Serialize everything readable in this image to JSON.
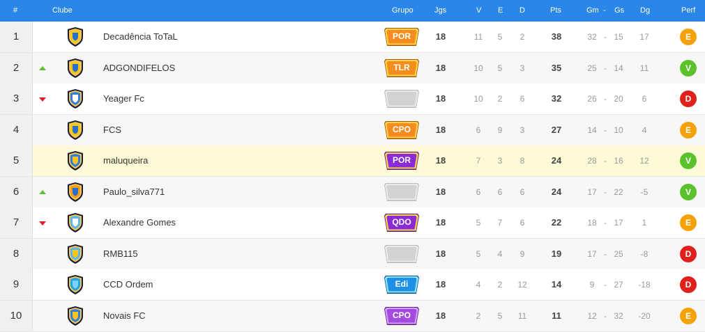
{
  "header": {
    "pos": "#",
    "clube": "Clube",
    "grupo": "Grupo",
    "jgs": "Jgs",
    "v": "V",
    "e": "E",
    "d": "D",
    "pts": "Pts",
    "gm": "Gm",
    "sep": "-",
    "gs": "Gs",
    "dg": "Dg",
    "perf": "Perf"
  },
  "colors": {
    "header_bg": "#2a86e8",
    "highlight_row": "#fdfbd7",
    "alt_row": "#f7f7f7",
    "perf_E": "#f5a20a",
    "perf_V": "#5bc22b",
    "perf_D": "#e0201b"
  },
  "rows": [
    {
      "pos": "1",
      "trend": "none",
      "team": "Decadência ToTaL",
      "crest": "shield-yellow-icon",
      "grupo": "POR",
      "grupo_style": "orange",
      "jgs": "18",
      "v": "11",
      "e": "5",
      "d": "2",
      "pts": "38",
      "gm": "32",
      "sep": "-",
      "gs": "15",
      "dg": "17",
      "perf": "E",
      "highlight": false
    },
    {
      "pos": "2",
      "trend": "up",
      "team": "ADGONDIFELOS",
      "crest": "shield-blue-yellow-icon",
      "grupo": "TLR",
      "grupo_style": "orange",
      "jgs": "18",
      "v": "10",
      "e": "5",
      "d": "3",
      "pts": "35",
      "gm": "25",
      "sep": "-",
      "gs": "14",
      "dg": "11",
      "perf": "V",
      "highlight": false
    },
    {
      "pos": "3",
      "trend": "down",
      "team": "Yeager Fc",
      "crest": "shield-blue-white-icon",
      "grupo": "",
      "grupo_style": "empty",
      "jgs": "18",
      "v": "10",
      "e": "2",
      "d": "6",
      "pts": "32",
      "gm": "26",
      "sep": "-",
      "gs": "20",
      "dg": "6",
      "perf": "D",
      "highlight": false
    },
    {
      "pos": "4",
      "trend": "none",
      "team": "FCS",
      "crest": "shield-yellow-blue-icon",
      "grupo": "CPO",
      "grupo_style": "orange",
      "jgs": "18",
      "v": "6",
      "e": "9",
      "d": "3",
      "pts": "27",
      "gm": "14",
      "sep": "-",
      "gs": "10",
      "dg": "4",
      "perf": "E",
      "highlight": false
    },
    {
      "pos": "5",
      "trend": "none",
      "team": "maluqueira",
      "crest": "shield-checkered-icon",
      "grupo": "POR",
      "grupo_style": "purple",
      "jgs": "18",
      "v": "7",
      "e": "3",
      "d": "8",
      "pts": "24",
      "gm": "28",
      "sep": "-",
      "gs": "16",
      "dg": "12",
      "perf": "V",
      "highlight": true
    },
    {
      "pos": "6",
      "trend": "up",
      "team": "Paulo_silva771",
      "crest": "shield-orange-blue-icon",
      "grupo": "",
      "grupo_style": "empty",
      "jgs": "18",
      "v": "6",
      "e": "6",
      "d": "6",
      "pts": "24",
      "gm": "17",
      "sep": "-",
      "gs": "22",
      "dg": "-5",
      "perf": "V",
      "highlight": false
    },
    {
      "pos": "7",
      "trend": "down",
      "team": "Alexandre Gomes",
      "crest": "shield-sky-blue-icon",
      "grupo": "QDO",
      "grupo_style": "purple",
      "jgs": "18",
      "v": "5",
      "e": "7",
      "d": "6",
      "pts": "22",
      "gm": "18",
      "sep": "-",
      "gs": "17",
      "dg": "1",
      "perf": "E",
      "highlight": false
    },
    {
      "pos": "8",
      "trend": "none",
      "team": "RMB115",
      "crest": "shield-striped-icon",
      "grupo": "",
      "grupo_style": "empty",
      "jgs": "18",
      "v": "5",
      "e": "4",
      "d": "9",
      "pts": "19",
      "gm": "17",
      "sep": "-",
      "gs": "25",
      "dg": "-8",
      "perf": "D",
      "highlight": false
    },
    {
      "pos": "9",
      "trend": "none",
      "team": "CCD Ordem",
      "crest": "shield-cyan-icon",
      "grupo": "Edi",
      "grupo_style": "teal",
      "jgs": "18",
      "v": "4",
      "e": "2",
      "d": "12",
      "pts": "14",
      "gm": "9",
      "sep": "-",
      "gs": "27",
      "dg": "-18",
      "perf": "D",
      "highlight": false
    },
    {
      "pos": "10",
      "trend": "none",
      "team": "Novais FC",
      "crest": "shield-cross-icon",
      "grupo": "CPO",
      "grupo_style": "violet",
      "jgs": "18",
      "v": "2",
      "e": "5",
      "d": "11",
      "pts": "11",
      "gm": "12",
      "sep": "-",
      "gs": "32",
      "dg": "-20",
      "perf": "E",
      "highlight": false
    }
  ]
}
